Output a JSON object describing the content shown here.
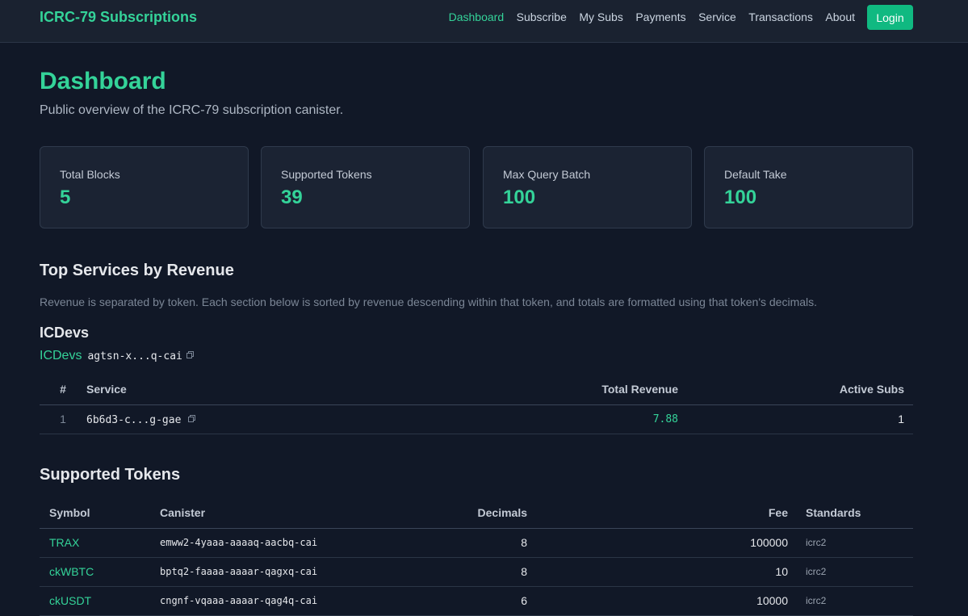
{
  "app": {
    "title": "ICRC-79 Subscriptions"
  },
  "nav": {
    "items": [
      {
        "label": "Dashboard"
      },
      {
        "label": "Subscribe"
      },
      {
        "label": "My Subs"
      },
      {
        "label": "Payments"
      },
      {
        "label": "Service"
      },
      {
        "label": "Transactions"
      },
      {
        "label": "About"
      }
    ],
    "login_label": "Login"
  },
  "page": {
    "title": "Dashboard",
    "subtitle": "Public overview of the ICRC-79 subscription canister."
  },
  "stats": [
    {
      "label": "Total Blocks",
      "value": "5"
    },
    {
      "label": "Supported Tokens",
      "value": "39"
    },
    {
      "label": "Max Query Batch",
      "value": "100"
    },
    {
      "label": "Default Take",
      "value": "100"
    }
  ],
  "top_services": {
    "title": "Top Services by Revenue",
    "note": "Revenue is separated by token. Each section below is sorted by revenue descending within that token, and totals are formatted using that token's decimals.",
    "groups": [
      {
        "title": "ICDevs",
        "token_name": "ICDevs",
        "token_principal": "agtsn-x...q-cai",
        "columns": {
          "rank": "#",
          "service": "Service",
          "revenue": "Total Revenue",
          "active": "Active Subs"
        },
        "rows": [
          {
            "rank": "1",
            "service": "6b6d3-c...g-gae",
            "revenue": "7.88",
            "active": "1"
          }
        ]
      }
    ]
  },
  "supported_tokens": {
    "title": "Supported Tokens",
    "columns": {
      "symbol": "Symbol",
      "canister": "Canister",
      "decimals": "Decimals",
      "fee": "Fee",
      "standards": "Standards"
    },
    "rows": [
      {
        "symbol": "TRAX",
        "canister": "emww2-4yaaa-aaaaq-aacbq-cai",
        "decimals": "8",
        "fee": "100000",
        "standards": "icrc2"
      },
      {
        "symbol": "ckWBTC",
        "canister": "bptq2-faaaa-aaaar-qagxq-cai",
        "decimals": "8",
        "fee": "10",
        "standards": "icrc2"
      },
      {
        "symbol": "ckUSDT",
        "canister": "cngnf-vqaaa-aaaar-qag4q-cai",
        "decimals": "6",
        "fee": "10000",
        "standards": "icrc2"
      }
    ]
  },
  "colors": {
    "background": "#111827",
    "accent": "#34d399",
    "button": "#10b981"
  },
  "icons": {
    "copy": "copy-icon"
  }
}
